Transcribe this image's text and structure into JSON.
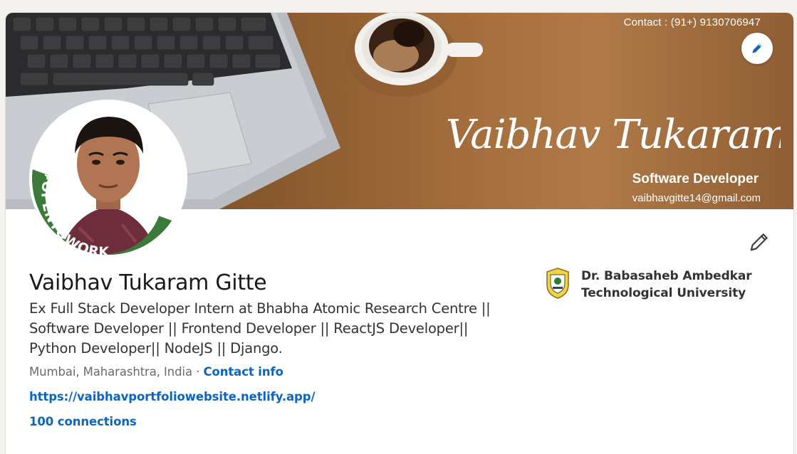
{
  "banner": {
    "contact": "Contact : (91+)  9130706947",
    "signature": "Vaibhav Tukaram Gitte",
    "role": "Software Developer",
    "email": "vaibhavgitte14@gmail.com"
  },
  "avatar": {
    "badge": "#OPENTOWORK"
  },
  "profile": {
    "name": "Vaibhav Tukaram Gitte",
    "headline_lines": [
      "Ex Full Stack Developer Intern at Bhabha Atomic Research Centre ||",
      "Software Developer || Frontend Developer || ReactJS Developer||",
      "Python Developer|| NodeJS || Django."
    ],
    "location": "Mumbai, Maharashtra, India",
    "separator": " · ",
    "contact_info": "Contact info",
    "website": "https://vaibhavportfoliowebsite.netlify.app/",
    "connections": "100 connections"
  },
  "education": {
    "line1": "Dr. Babasaheb Ambedkar",
    "line2": "Technological University"
  },
  "colors": {
    "accent": "#0a66c2",
    "open_to_work_green": "#3c7a3a",
    "text": "#191919"
  },
  "icons": {
    "banner_edit": "pencil-icon",
    "intro_edit": "pencil-icon"
  }
}
